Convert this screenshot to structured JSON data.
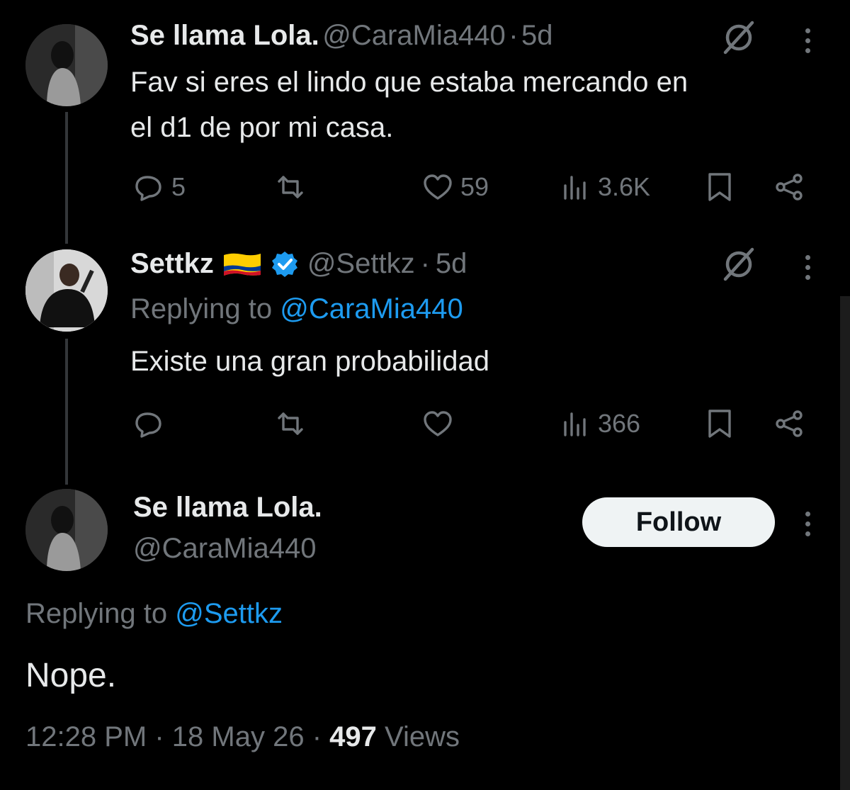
{
  "tweets": [
    {
      "name": "Se llama Lola.",
      "handle": "@CaraMia440",
      "time": "5d",
      "text_line1": "Fav si eres el lindo que estaba mercando en",
      "text_line2": "el d1 de por mi casa.",
      "replies": "5",
      "likes": "59",
      "views": "3.6K"
    },
    {
      "name": "Settkz",
      "flag_icon": "colombia-flag-icon",
      "verified_icon": "verified-badge-icon",
      "handle": "@Settkz",
      "time": "5d",
      "replying_prefix": "Replying to",
      "replying_to": "@CaraMia440",
      "text": "Existe una gran probabilidad",
      "views": "366"
    }
  ],
  "focused": {
    "name": "Se llama Lola.",
    "handle": "@CaraMia440",
    "follow_label": "Follow",
    "replying_prefix": "Replying to",
    "replying_to": "@Settkz",
    "text": "Nope.",
    "timestamp": "12:28 PM",
    "date": "18 May 26",
    "views_count": "497",
    "views_label": "Views",
    "separator": "·"
  },
  "colors": {
    "background": "#000000",
    "text_primary": "#e7e9ea",
    "text_secondary": "#71767b",
    "link": "#1d9bf0",
    "verified": "#1d9bf0",
    "follow_bg": "#eff3f4"
  }
}
